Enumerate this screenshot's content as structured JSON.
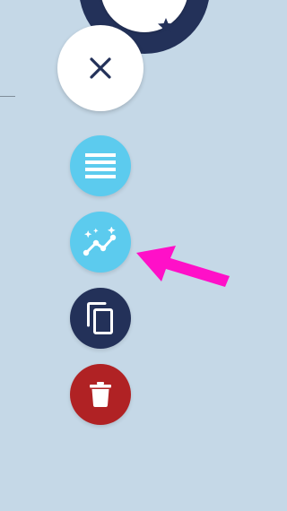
{
  "menu": {
    "top_button_icon": "star-icon",
    "close_button_icon": "close-icon",
    "actions": [
      {
        "name": "list",
        "icon": "list-icon",
        "color": "#5ccbee"
      },
      {
        "name": "insights",
        "icon": "sparkle-chart-icon",
        "color": "#5ccbee"
      },
      {
        "name": "duplicate",
        "icon": "copy-icon",
        "color": "#233159"
      },
      {
        "name": "delete",
        "icon": "trash-icon",
        "color": "#b02224"
      }
    ]
  },
  "annotation": {
    "icon": "arrow-pointer-icon",
    "color": "#ff10c8"
  },
  "colors": {
    "background": "#c5d8e7",
    "primary_dark": "#233159",
    "accent": "#5ccbee"
  }
}
